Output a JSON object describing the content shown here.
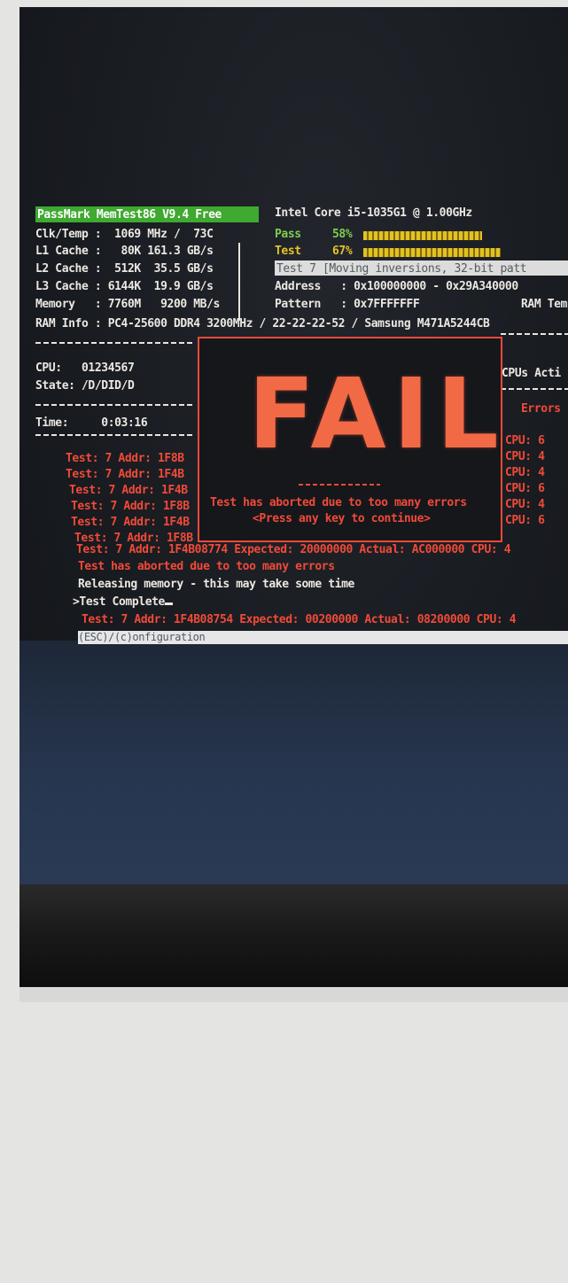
{
  "header": {
    "app_title": "PassMark MemTest86 V9.4 Free",
    "cpu_name": "Intel Core i5-1035G1 @ 1.00GHz"
  },
  "system": {
    "clk_temp": "Clk/Temp :  1069 MHz /  73C",
    "l1": "L1 Cache :   80K 161.3 GB/s",
    "l2": "L2 Cache :  512K  35.5 GB/s",
    "l3": "L3 Cache : 6144K  19.9 GB/s",
    "memory": "Memory   : 7760M   9200 MB/s",
    "ram_info": "RAM Info : PC4-25600 DDR4 3200MHz / 22-22-22-52 / Samsung M471A5244CB"
  },
  "progress": {
    "pass_label": "Pass",
    "pass_pct": "58%",
    "pass_value": 58,
    "test_label": "Test",
    "test_pct": "67%",
    "test_value": 67,
    "current_test": "Test 7 [Moving inversions, 32-bit patt",
    "address": "Address   : 0x100000000 - 0x29A340000",
    "pattern": "Pattern   : 0x7FFFFFFF",
    "ram_temp": "RAM Temp"
  },
  "status": {
    "cpu": "CPU:   01234567",
    "state": "State: /D/DID/D",
    "time": "Time:     0:03:16",
    "cpus_active": "CPUs Acti",
    "errors": "Errors"
  },
  "errors_left": [
    "Test: 7 Addr: 1F8B",
    "Test: 7 Addr: 1F4B",
    "Test: 7 Addr: 1F4B",
    "Test: 7 Addr: 1F8B",
    "Test: 7 Addr: 1F4B",
    "Test: 7 Addr: 1F8B"
  ],
  "errors_right": [
    "CPU: 6",
    "CPU: 4",
    "CPU: 4",
    "CPU: 6",
    "CPU: 4",
    "CPU: 6"
  ],
  "dialog": {
    "big_text": "FAIL",
    "message": "Test has aborted due to too many errors",
    "prompt": "<Press any key to continue>"
  },
  "log": {
    "line1": "Test: 7 Addr: 1F4B08774 Expected: 20000000 Actual: AC000000 CPU: 4",
    "line2": "Test has aborted due to too many errors",
    "line3": "Releasing memory - this may take some time",
    "line4": ">Test Complete",
    "line5": "Test: 7 Addr: 1F4B08754 Expected: 00200000 Actual: 08200000 CPU: 4"
  },
  "footer": {
    "config": "(ESC)/(c)onfiguration"
  },
  "colors": {
    "error_red": "#f04a38",
    "pass_green": "#7fce4e",
    "test_yellow": "#e6c227",
    "title_green": "#3fa930"
  }
}
